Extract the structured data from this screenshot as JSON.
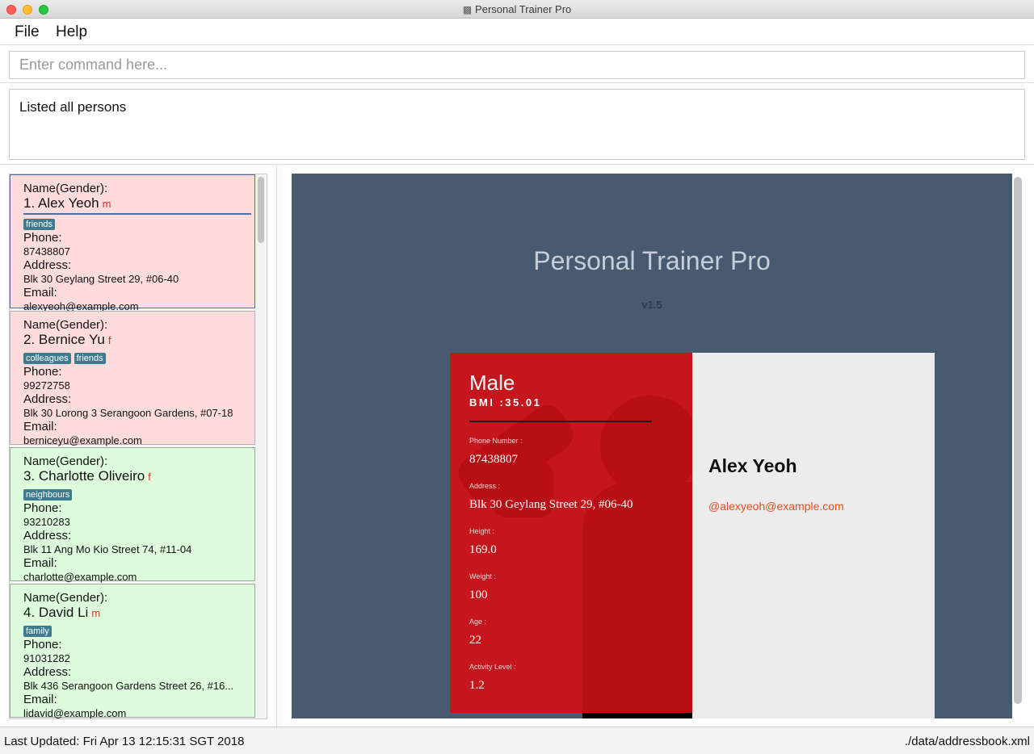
{
  "window": {
    "title": "Personal Trainer Pro",
    "title_icon": "dumbbell-icon"
  },
  "menu": {
    "file": "File",
    "help": "Help"
  },
  "command": {
    "placeholder": "Enter command here...",
    "value": ""
  },
  "result": {
    "text": "Listed all persons"
  },
  "persons": [
    {
      "name_label": "Name(Gender):",
      "index_name": "1.  Alex Yeoh",
      "gender": "m",
      "tags": [
        "friends"
      ],
      "phone_label": "Phone:",
      "phone": "87438807",
      "address_label": "Address:",
      "address": "Blk 30 Geylang Street 29, #06-40",
      "email_label": "Email:",
      "email": "alexyeoh@example.com",
      "color": "#ffdcdc",
      "selected": true
    },
    {
      "name_label": "Name(Gender):",
      "index_name": "2.  Bernice Yu",
      "gender": "f",
      "tags": [
        "colleagues",
        "friends"
      ],
      "phone_label": "Phone:",
      "phone": "99272758",
      "address_label": "Address:",
      "address": "Blk 30 Lorong 3 Serangoon Gardens, #07-18",
      "email_label": "Email:",
      "email": "berniceyu@example.com",
      "color": "#ffdcdc",
      "selected": false
    },
    {
      "name_label": "Name(Gender):",
      "index_name": "3.  Charlotte Oliveiro",
      "gender": "f",
      "tags": [
        "neighbours"
      ],
      "phone_label": "Phone:",
      "phone": "93210283",
      "address_label": "Address:",
      "address": "Blk 11 Ang Mo Kio Street 74, #11-04",
      "email_label": "Email:",
      "email": "charlotte@example.com",
      "color": "#dcfcdc",
      "selected": false
    },
    {
      "name_label": "Name(Gender):",
      "index_name": "4.  David Li",
      "gender": "m",
      "tags": [
        "family"
      ],
      "phone_label": "Phone:",
      "phone": "91031282",
      "address_label": "Address:",
      "address": "Blk 436 Serangoon Gardens Street 26, #16...",
      "email_label": "Email:",
      "email": "lidavid@example.com",
      "color": "#dcfcdc",
      "selected": false
    }
  ],
  "browser": {
    "app_title": "Personal Trainer Pro",
    "version": "v1.5",
    "profile": {
      "gender": "Male",
      "bmi": "BMI :35.01",
      "fields": [
        {
          "label": "Phone Number :",
          "value": "87438807"
        },
        {
          "label": "Address :",
          "value": "Blk 30 Geylang Street 29, #06-40"
        },
        {
          "label": "Height :",
          "value": "169.0"
        },
        {
          "label": "Weight :",
          "value": "100"
        },
        {
          "label": "Age :",
          "value": "22"
        },
        {
          "label": "Activity Level :",
          "value": "1.2"
        }
      ],
      "name": "Alex Yeoh",
      "email": "@alexyeoh@example.com",
      "accent": "#c4161c",
      "watermark_icon": "fitness-person-icon"
    }
  },
  "status": {
    "last_updated": "Last Updated: Fri Apr 13 12:15:31 SGT 2018",
    "file_path": "./data/addressbook.xml"
  }
}
